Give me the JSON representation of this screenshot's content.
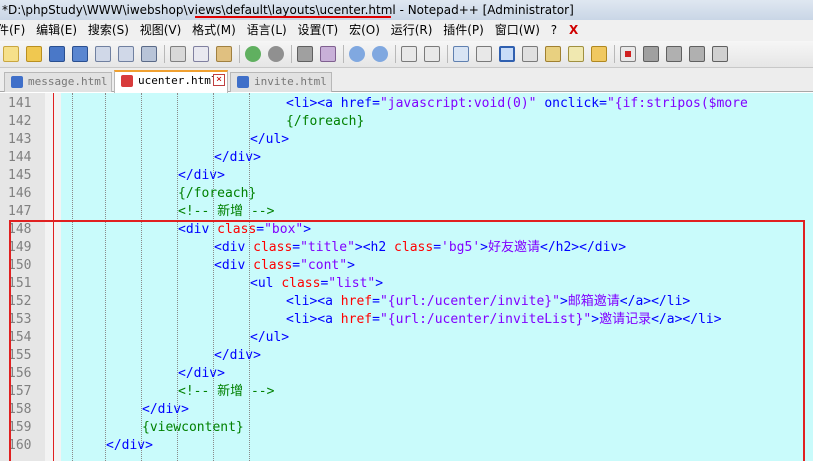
{
  "window": {
    "title_prefix": "*D:\\phpStudy\\WWW\\iwebshop\\",
    "title_views": "views",
    "title_mid1": "\\",
    "title_default": "default",
    "title_mid2": "\\",
    "title_layouts": "layouts",
    "title_mid3": "\\",
    "title_file": "ucenter.html",
    "title_suffix": " - Notepad++ [Administrator]"
  },
  "menu": {
    "items": [
      "件(F)",
      "编辑(E)",
      "搜索(S)",
      "视图(V)",
      "格式(M)",
      "语言(L)",
      "设置(T)",
      "宏(O)",
      "运行(R)",
      "插件(P)",
      "窗口(W)",
      "?"
    ],
    "close_glyph": "X"
  },
  "tabs": [
    {
      "label": "message.html",
      "active": false,
      "icon_color": "#3f6fc9"
    },
    {
      "label": "ucenter.html",
      "active": true,
      "icon_color": "#d83b3b"
    },
    {
      "label": "invite.html",
      "active": false,
      "icon_color": "#3f6fc9"
    }
  ],
  "tab_close_glyph": "×",
  "colors": {
    "editor_bg": "#c9fbfb",
    "tag": "#0000ff",
    "attribute": "#ff0000",
    "value": "#8000ff",
    "comment": "#008000",
    "highlight": "#e02020"
  },
  "code_lines": [
    {
      "n": "141",
      "indent": 12,
      "tokens": [
        [
          "tag",
          "<li><a "
        ],
        [
          "tag",
          "href"
        ],
        [
          "tag",
          "="
        ],
        [
          "val",
          "\"javascript:void(0)\""
        ],
        [
          "txt",
          " "
        ],
        [
          "tag",
          "onclick"
        ],
        [
          "tag",
          "="
        ],
        [
          "val",
          "\"{if:stripos($more"
        ]
      ]
    },
    {
      "n": "142",
      "indent": 12,
      "tokens": [
        [
          "tpl",
          "{/foreach}"
        ]
      ]
    },
    {
      "n": "143",
      "indent": 10,
      "tokens": [
        [
          "tag",
          "</ul>"
        ]
      ]
    },
    {
      "n": "144",
      "indent": 8,
      "tokens": [
        [
          "tag",
          "</div>"
        ]
      ]
    },
    {
      "n": "145",
      "indent": 6,
      "tokens": [
        [
          "tag",
          "</div>"
        ]
      ]
    },
    {
      "n": "146",
      "indent": 6,
      "tokens": [
        [
          "tpl",
          "{/foreach}"
        ]
      ]
    },
    {
      "n": "147",
      "indent": 6,
      "tokens": [
        [
          "cmt",
          "<!-- 新增 -->"
        ]
      ]
    },
    {
      "n": "148",
      "indent": 6,
      "tokens": [
        [
          "tag",
          "<div "
        ],
        [
          "attr",
          "class"
        ],
        [
          "tag",
          "="
        ],
        [
          "val",
          "\"box\""
        ],
        [
          "tag",
          ">"
        ]
      ]
    },
    {
      "n": "149",
      "indent": 8,
      "tokens": [
        [
          "tag",
          "<div "
        ],
        [
          "attr",
          "class"
        ],
        [
          "tag",
          "="
        ],
        [
          "val",
          "\"title\""
        ],
        [
          "tag",
          "><h2 "
        ],
        [
          "attr",
          "class"
        ],
        [
          "tag",
          "="
        ],
        [
          "val",
          "'bg5'"
        ],
        [
          "tag",
          ">"
        ],
        [
          "val",
          "好友邀请"
        ],
        [
          "tag",
          "</h2></div>"
        ]
      ]
    },
    {
      "n": "150",
      "indent": 8,
      "tokens": [
        [
          "tag",
          "<div "
        ],
        [
          "attr",
          "class"
        ],
        [
          "tag",
          "="
        ],
        [
          "val",
          "\"cont\""
        ],
        [
          "tag",
          ">"
        ]
      ]
    },
    {
      "n": "151",
      "indent": 10,
      "tokens": [
        [
          "tag",
          "<ul "
        ],
        [
          "attr",
          "class"
        ],
        [
          "tag",
          "="
        ],
        [
          "val",
          "\"list\""
        ],
        [
          "tag",
          ">"
        ]
      ]
    },
    {
      "n": "152",
      "indent": 12,
      "tokens": [
        [
          "tag",
          "<li><a "
        ],
        [
          "attr",
          "href"
        ],
        [
          "tag",
          "="
        ],
        [
          "val",
          "\"{url:/ucenter/invite}\""
        ],
        [
          "tag",
          ">"
        ],
        [
          "val",
          "邮箱邀请"
        ],
        [
          "tag",
          "</a></li>"
        ]
      ]
    },
    {
      "n": "153",
      "indent": 12,
      "tokens": [
        [
          "tag",
          "<li><a "
        ],
        [
          "attr",
          "href"
        ],
        [
          "tag",
          "="
        ],
        [
          "val",
          "\"{url:/ucenter/inviteList}\""
        ],
        [
          "tag",
          ">"
        ],
        [
          "val",
          "邀请记录"
        ],
        [
          "tag",
          "</a></li>"
        ]
      ]
    },
    {
      "n": "154",
      "indent": 10,
      "tokens": [
        [
          "tag",
          "</ul>"
        ]
      ]
    },
    {
      "n": "155",
      "indent": 8,
      "tokens": [
        [
          "tag",
          "</div>"
        ]
      ]
    },
    {
      "n": "156",
      "indent": 6,
      "tokens": [
        [
          "tag",
          "</div>"
        ]
      ]
    },
    {
      "n": "157",
      "indent": 6,
      "tokens": [
        [
          "cmt",
          "<!-- 新增 -->"
        ]
      ]
    },
    {
      "n": "158",
      "indent": 4,
      "tokens": [
        [
          "tag",
          "</div>"
        ]
      ]
    },
    {
      "n": "159",
      "indent": 4,
      "tokens": [
        [
          "tpl",
          "{viewcontent}"
        ]
      ]
    },
    {
      "n": "160",
      "indent": 2,
      "tokens": [
        [
          "tag",
          "</div>"
        ]
      ]
    }
  ]
}
